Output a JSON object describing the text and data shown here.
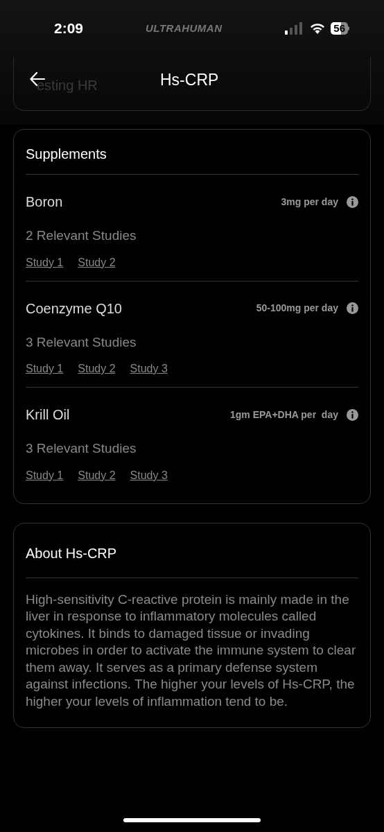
{
  "status_bar": {
    "time": "2:09",
    "carrier": "ULTRAHUMAN",
    "battery": "56"
  },
  "header": {
    "title": "Hs-CRP",
    "behind_text": "esting HR"
  },
  "supplements": {
    "title": "Supplements",
    "items": [
      {
        "name": "Boron",
        "dose": "3mg per day",
        "studies_count": "2 Relevant Studies",
        "studies": [
          "Study 1",
          "Study 2"
        ]
      },
      {
        "name": "Coenzyme Q10",
        "dose": "50-100mg per day",
        "studies_count": "3 Relevant Studies",
        "studies": [
          "Study 1",
          "Study 2",
          "Study 3"
        ]
      },
      {
        "name": "Krill Oil",
        "dose": "1gm EPA+DHA per  day",
        "studies_count": "3 Relevant Studies",
        "studies": [
          "Study 1",
          "Study 2",
          "Study 3"
        ]
      }
    ]
  },
  "about": {
    "title": "About Hs-CRP",
    "text": "High-sensitivity C-reactive protein is mainly made in the liver in response to inflammatory molecules called cytokines. It binds to damaged tissue or invading microbes in order to activate the immune system to clear them away. It serves as a primary defense system against infections. The higher your levels of Hs-CRP, the higher your levels of inflammation tend to be."
  }
}
